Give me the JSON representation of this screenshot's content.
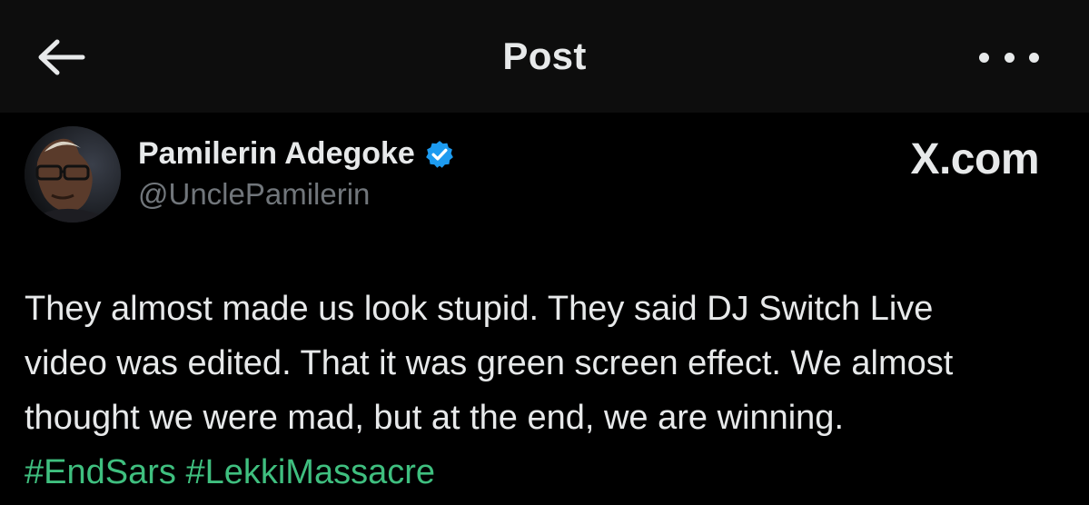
{
  "header": {
    "title": "Post",
    "back_icon": "arrow-left-icon",
    "more_icon": "more-horizontal-icon"
  },
  "post": {
    "author_name": "Pamilerin Adegoke",
    "author_handle": "@UnclePamilerin",
    "verified_icon": "verified-badge-icon",
    "verified_color": "#1d9bf0",
    "text_lines": [
      "They almost made us look stupid. They said DJ Switch Live",
      "video was edited. That it was green screen effect. We almost",
      "thought we were mad, but at the end, we are winning."
    ],
    "hashtags": [
      "#EndSars",
      "#LekkiMassacre"
    ],
    "hashtag_color": "#3fbf7f"
  },
  "watermark": {
    "label": "X.com"
  },
  "colors": {
    "background": "#000000",
    "topbar": "#0d0d0d",
    "primary_text": "#e7e9ea",
    "secondary_text": "#71767b"
  }
}
